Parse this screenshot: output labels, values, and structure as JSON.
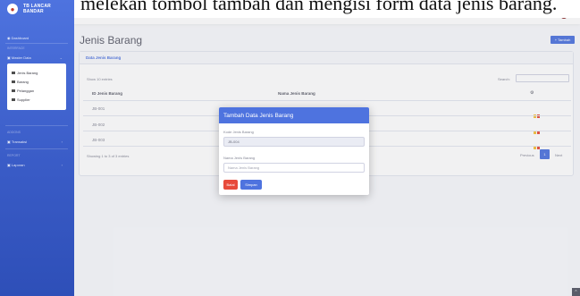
{
  "caption": "melekan tombol tambah dan mengisi form data jenis barang.",
  "brand": {
    "line1": "TB LANCAR",
    "line2": "BANDAR"
  },
  "sidebar": {
    "dashboard": "Dashboard",
    "heading1": "Interface",
    "master": "Master Data",
    "sub_items": [
      "Jenis Barang",
      "Barang",
      "Pelanggan",
      "Supplier"
    ],
    "heading2": "Addons",
    "transaksi": "Transaksi",
    "heading3": "Report",
    "laporan": "Laporan"
  },
  "topbar": {
    "user": "Admin"
  },
  "page": {
    "title": "Jenis Barang",
    "add_button": "+ Tambah"
  },
  "card": {
    "title": "Data Jenis Barang",
    "show_entries": "Show 10 entries",
    "search_label": "Search:",
    "columns": [
      "ID Jenis Barang",
      "Nama Jenis Barang"
    ],
    "rows": [
      {
        "id": "JB-001"
      },
      {
        "id": "JB-002"
      },
      {
        "id": "JB-003"
      }
    ],
    "info": "Showing 1 to 3 of 3 entries",
    "pagination": {
      "prev": "Previous",
      "page": "1",
      "next": "Next"
    }
  },
  "modal": {
    "title": "Tambah Data Jenis Barang",
    "kode_label": "Kode Jenis Barang",
    "kode_value": "JB-004",
    "nama_label": "Nama Jenis Barang",
    "nama_placeholder": "Nama Jenis Barang",
    "cancel": "Batal",
    "save": "Simpan"
  },
  "colors": {
    "primary": "#4e73df",
    "danger": "#e74a3b",
    "warning": "#f6c23e"
  }
}
